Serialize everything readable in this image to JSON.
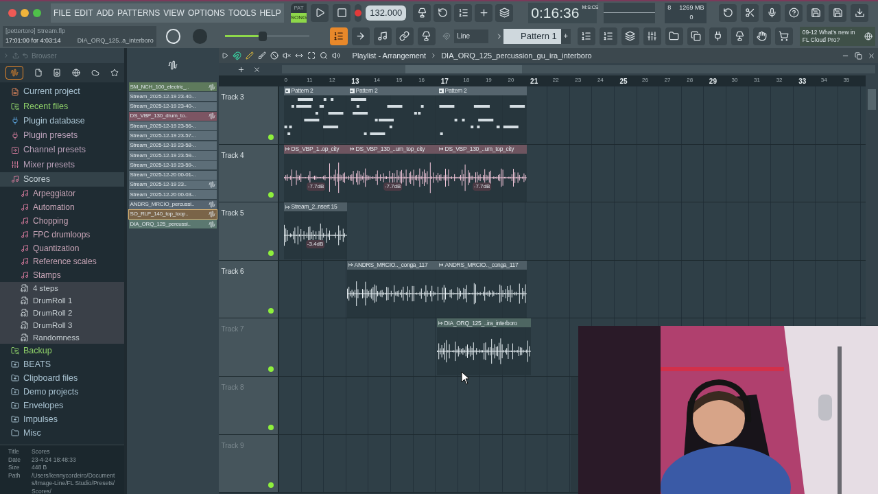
{
  "menu": [
    "FILE",
    "EDIT",
    "ADD",
    "PATTERNS",
    "VIEW",
    "OPTIONS",
    "TOOLS",
    "HELP"
  ],
  "transport": {
    "modes": [
      {
        "label": "PAT",
        "selected": false
      },
      {
        "label": "SONG",
        "selected": true
      }
    ],
    "tempo": "132.000",
    "time": "0:16:36",
    "time_format": "M:S:CS",
    "cpu": "8",
    "memory": "1269 MB",
    "polyphony": "0"
  },
  "project": {
    "title": "[pettertoro] Stream.flp",
    "time": "17:01:00 for 4:03:14",
    "hint": "DIA_ORQ_125..a_interboro"
  },
  "master_volume": {
    "level": 0.45
  },
  "snap": "Line",
  "pattern": "Pattern 1",
  "pattern_add": "+",
  "news": {
    "date": "09-12",
    "text": "What's new in FL Cloud Pro?"
  },
  "browser": {
    "title": "Browser",
    "tree": [
      {
        "kind": "project",
        "label": "Current project",
        "selected": false
      },
      {
        "kind": "recent",
        "label": "Recent files",
        "selected": false
      },
      {
        "kind": "plugin",
        "label": "Plugin database",
        "selected": false
      },
      {
        "kind": "plugin-preset",
        "label": "Plugin presets",
        "selected": false
      },
      {
        "kind": "channel-preset",
        "label": "Channel presets",
        "selected": false
      },
      {
        "kind": "mixer-preset",
        "label": "Mixer presets",
        "selected": false
      },
      {
        "kind": "score",
        "label": "Scores",
        "selected": true,
        "children": [
          {
            "kind": "note",
            "label": "Arpeggiator"
          },
          {
            "kind": "note",
            "label": "Automation"
          },
          {
            "kind": "note",
            "label": "Chopping"
          },
          {
            "kind": "note",
            "label": "FPC drumloops"
          },
          {
            "kind": "note",
            "label": "Quantization"
          },
          {
            "kind": "note",
            "label": "Reference scales"
          },
          {
            "kind": "note",
            "label": "Stamps"
          },
          {
            "kind": "file",
            "label": "4 steps"
          },
          {
            "kind": "file",
            "label": "DrumRoll 1"
          },
          {
            "kind": "file",
            "label": "DrumRoll 2"
          },
          {
            "kind": "file",
            "label": "DrumRoll 3"
          },
          {
            "kind": "file",
            "label": "Randomness"
          }
        ]
      },
      {
        "kind": "recent",
        "label": "Backup",
        "selected": false
      },
      {
        "kind": "folder",
        "label": "BEATS",
        "selected": false
      },
      {
        "kind": "folder",
        "label": "Clipboard files",
        "selected": false
      },
      {
        "kind": "folder",
        "label": "Demo projects",
        "selected": false
      },
      {
        "kind": "folder",
        "label": "Envelopes",
        "selected": false
      },
      {
        "kind": "folder",
        "label": "Impulses",
        "selected": false
      },
      {
        "kind": "plain-folder",
        "label": "Misc",
        "selected": false
      }
    ],
    "info": [
      {
        "label": "Title",
        "value": "Scores"
      },
      {
        "label": "Date",
        "value": "23-4-24 18:48:33"
      },
      {
        "label": "Size",
        "value": "448 B"
      },
      {
        "label": "Path",
        "value": "/Users/kennycordeiro/Documents/Image-Line/FL Studio/Presets/Scores/"
      }
    ]
  },
  "picker": [
    {
      "name": "SM_NCH_100_electric_..",
      "color": "#5e7a5c",
      "audio": true,
      "selected": false
    },
    {
      "name": "Stream_2025-12-19 23-40-..",
      "color": "#5d6e78",
      "audio": false,
      "selected": false
    },
    {
      "name": "Stream_2025-12-19 23-40-..",
      "color": "#5d6e78",
      "audio": false,
      "selected": false
    },
    {
      "name": "DS_VBP_130_drum_to..",
      "color": "#7c5563",
      "audio": true,
      "selected": false
    },
    {
      "name": "Stream_2025-12-19 23-56-..",
      "color": "#5d6e78",
      "audio": false,
      "selected": false
    },
    {
      "name": "Stream_2025-12-19 23-57-..",
      "color": "#5d6e78",
      "audio": false,
      "selected": false
    },
    {
      "name": "Stream_2025-12-19 23-58-..",
      "color": "#5d6e78",
      "audio": false,
      "selected": false
    },
    {
      "name": "Stream_2025-12-19 23-59-..",
      "color": "#5d6e78",
      "audio": false,
      "selected": false
    },
    {
      "name": "Stream_2025-12-19 23-59-..",
      "color": "#5d6e78",
      "audio": false,
      "selected": false
    },
    {
      "name": "Stream_2025-12-20 00-01-..",
      "color": "#5d6e78",
      "audio": false,
      "selected": false
    },
    {
      "name": "Stream_2025-12-19 23..",
      "color": "#5d6e78",
      "audio": true,
      "selected": false
    },
    {
      "name": "Stream_2025-12-20 00-03-..",
      "color": "#5d6e78",
      "audio": false,
      "selected": false
    },
    {
      "name": "ANDRS_MRCIO_percussi..",
      "color": "#566470",
      "audio": true,
      "selected": false
    },
    {
      "name": "SO_RLP_140_top_loop..",
      "color": "#7a6448",
      "audio": true,
      "selected": true
    },
    {
      "name": "DIA_ORQ_125_percussi..",
      "color": "#5b7870",
      "audio": true,
      "selected": false
    }
  ],
  "playlist": {
    "title": "Playlist - Arrangement",
    "clip": "DIA_ORQ_125_percussion_gu_ira_interboro",
    "bars": [
      "0",
      "11",
      "12",
      "13",
      "14",
      "15",
      "16",
      "17",
      "18",
      "19",
      "20",
      "21",
      "22",
      "23",
      "24",
      "25",
      "26",
      "27",
      "28",
      "29",
      "30",
      "31",
      "32",
      "33",
      "34",
      "35"
    ],
    "tracks": [
      {
        "name": "Track 3",
        "dimmed": false,
        "clips": [
          {
            "kind": "pattern",
            "label": "Pattern 2",
            "color": "#56656e"
          },
          {
            "kind": "pattern",
            "label": "Pattern 2",
            "color": "#56656e"
          },
          {
            "kind": "pattern",
            "label": "Pattern 2",
            "color": "#56656e"
          }
        ]
      },
      {
        "name": "Track 4",
        "dimmed": false,
        "clips": [
          {
            "kind": "audio",
            "label": "DS_VBP_1..op_city",
            "color": "#6e5560",
            "gain": "-7.7dB"
          },
          {
            "kind": "audio",
            "label": "DS_VBP_130_..um_top_city",
            "color": "#6e5560",
            "gain": "-7.7dB"
          },
          {
            "kind": "audio",
            "label": "DS_VBP_130_..um_top_city",
            "color": "#6e5560",
            "gain": "-7.7dB"
          }
        ]
      },
      {
        "name": "Track 5",
        "dimmed": false,
        "clips": [
          {
            "kind": "audio",
            "label": "Stream_2..nsert 15",
            "color": "#4f5e66",
            "gain": "-3.4dB"
          }
        ]
      },
      {
        "name": "Track 6",
        "dimmed": false,
        "clips": [
          {
            "kind": "audio",
            "label": "ANDRS_MRCIO.._conga_117",
            "color": "#4f5e66"
          },
          {
            "kind": "audio",
            "label": "ANDRS_MRCIO.._conga_117",
            "color": "#4f5e66"
          }
        ]
      },
      {
        "name": "Track 7",
        "dimmed": true,
        "clips": [
          {
            "kind": "audio",
            "label": "DIA_ORQ_125_..ira_interboro",
            "color": "#4e6662"
          }
        ]
      },
      {
        "name": "Track 8",
        "dimmed": true
      },
      {
        "name": "Track 9",
        "dimmed": true
      }
    ]
  }
}
